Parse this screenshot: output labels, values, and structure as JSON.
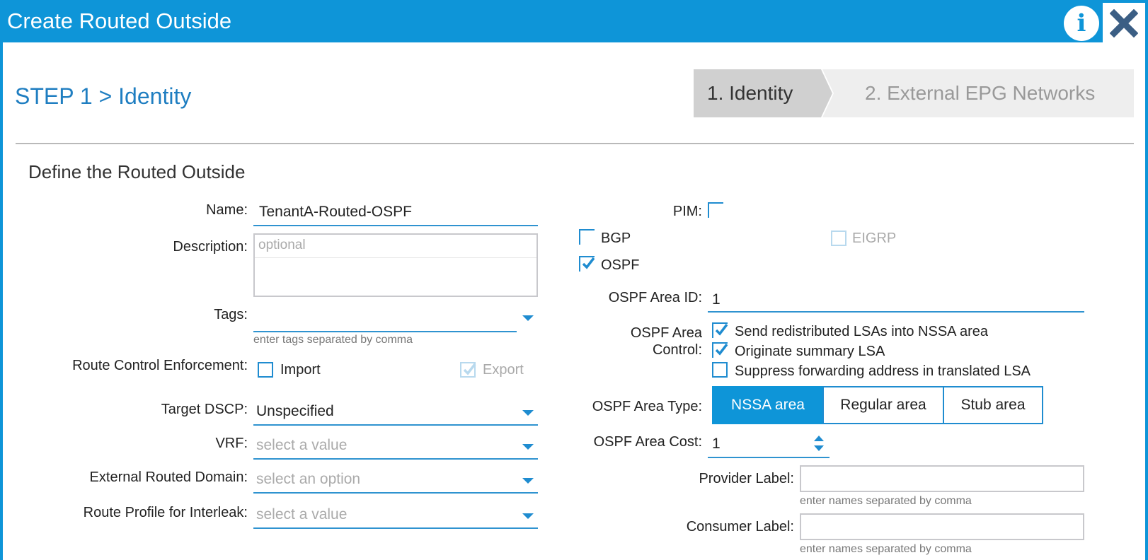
{
  "window": {
    "title": "Create Routed Outside"
  },
  "step": {
    "heading": "STEP 1 > Identity"
  },
  "wizard": {
    "steps": [
      {
        "label": "1. Identity"
      },
      {
        "label": "2. External EPG Networks"
      }
    ]
  },
  "section": {
    "title": "Define the Routed Outside"
  },
  "left": {
    "name": {
      "label": "Name:",
      "value": "TenantA-Routed-OSPF"
    },
    "description": {
      "label": "Description:",
      "placeholder": "optional"
    },
    "tags": {
      "label": "Tags:",
      "help": "enter tags separated by comma"
    },
    "route_control": {
      "label": "Route Control Enforcement:",
      "import_label": "Import",
      "export_label": "Export"
    },
    "target_dscp": {
      "label": "Target DSCP:",
      "value": "Unspecified"
    },
    "vrf": {
      "label": "VRF:",
      "placeholder": "select a value"
    },
    "ext_domain": {
      "label": "External Routed Domain:",
      "placeholder": "select an option"
    },
    "route_profile": {
      "label": "Route Profile for Interleak:",
      "placeholder": "select a value"
    }
  },
  "right": {
    "pim": {
      "label": "PIM:"
    },
    "bgp": {
      "label": "BGP"
    },
    "eigrp": {
      "label": "EIGRP"
    },
    "ospf": {
      "label": "OSPF"
    },
    "area_id": {
      "label": "OSPF Area ID:",
      "value": "1"
    },
    "area_control": {
      "label_line1": "OSPF Area",
      "label_line2": "Control:",
      "options": [
        {
          "label": "Send redistributed LSAs into NSSA area",
          "checked": true
        },
        {
          "label": "Originate summary LSA",
          "checked": true
        },
        {
          "label": "Suppress forwarding address in translated LSA",
          "checked": false
        }
      ]
    },
    "area_type": {
      "label": "OSPF Area Type:",
      "options": [
        "NSSA area",
        "Regular area",
        "Stub area"
      ],
      "selected": "NSSA area"
    },
    "area_cost": {
      "label": "OSPF Area Cost:",
      "value": "1"
    },
    "provider": {
      "label": "Provider Label:",
      "help": "enter names separated by comma"
    },
    "consumer": {
      "label": "Consumer Label:",
      "help": "enter names separated by comma"
    }
  },
  "colors": {
    "accent": "#0e95d8",
    "link": "#1f7ec1",
    "border": "#2f93d0"
  }
}
